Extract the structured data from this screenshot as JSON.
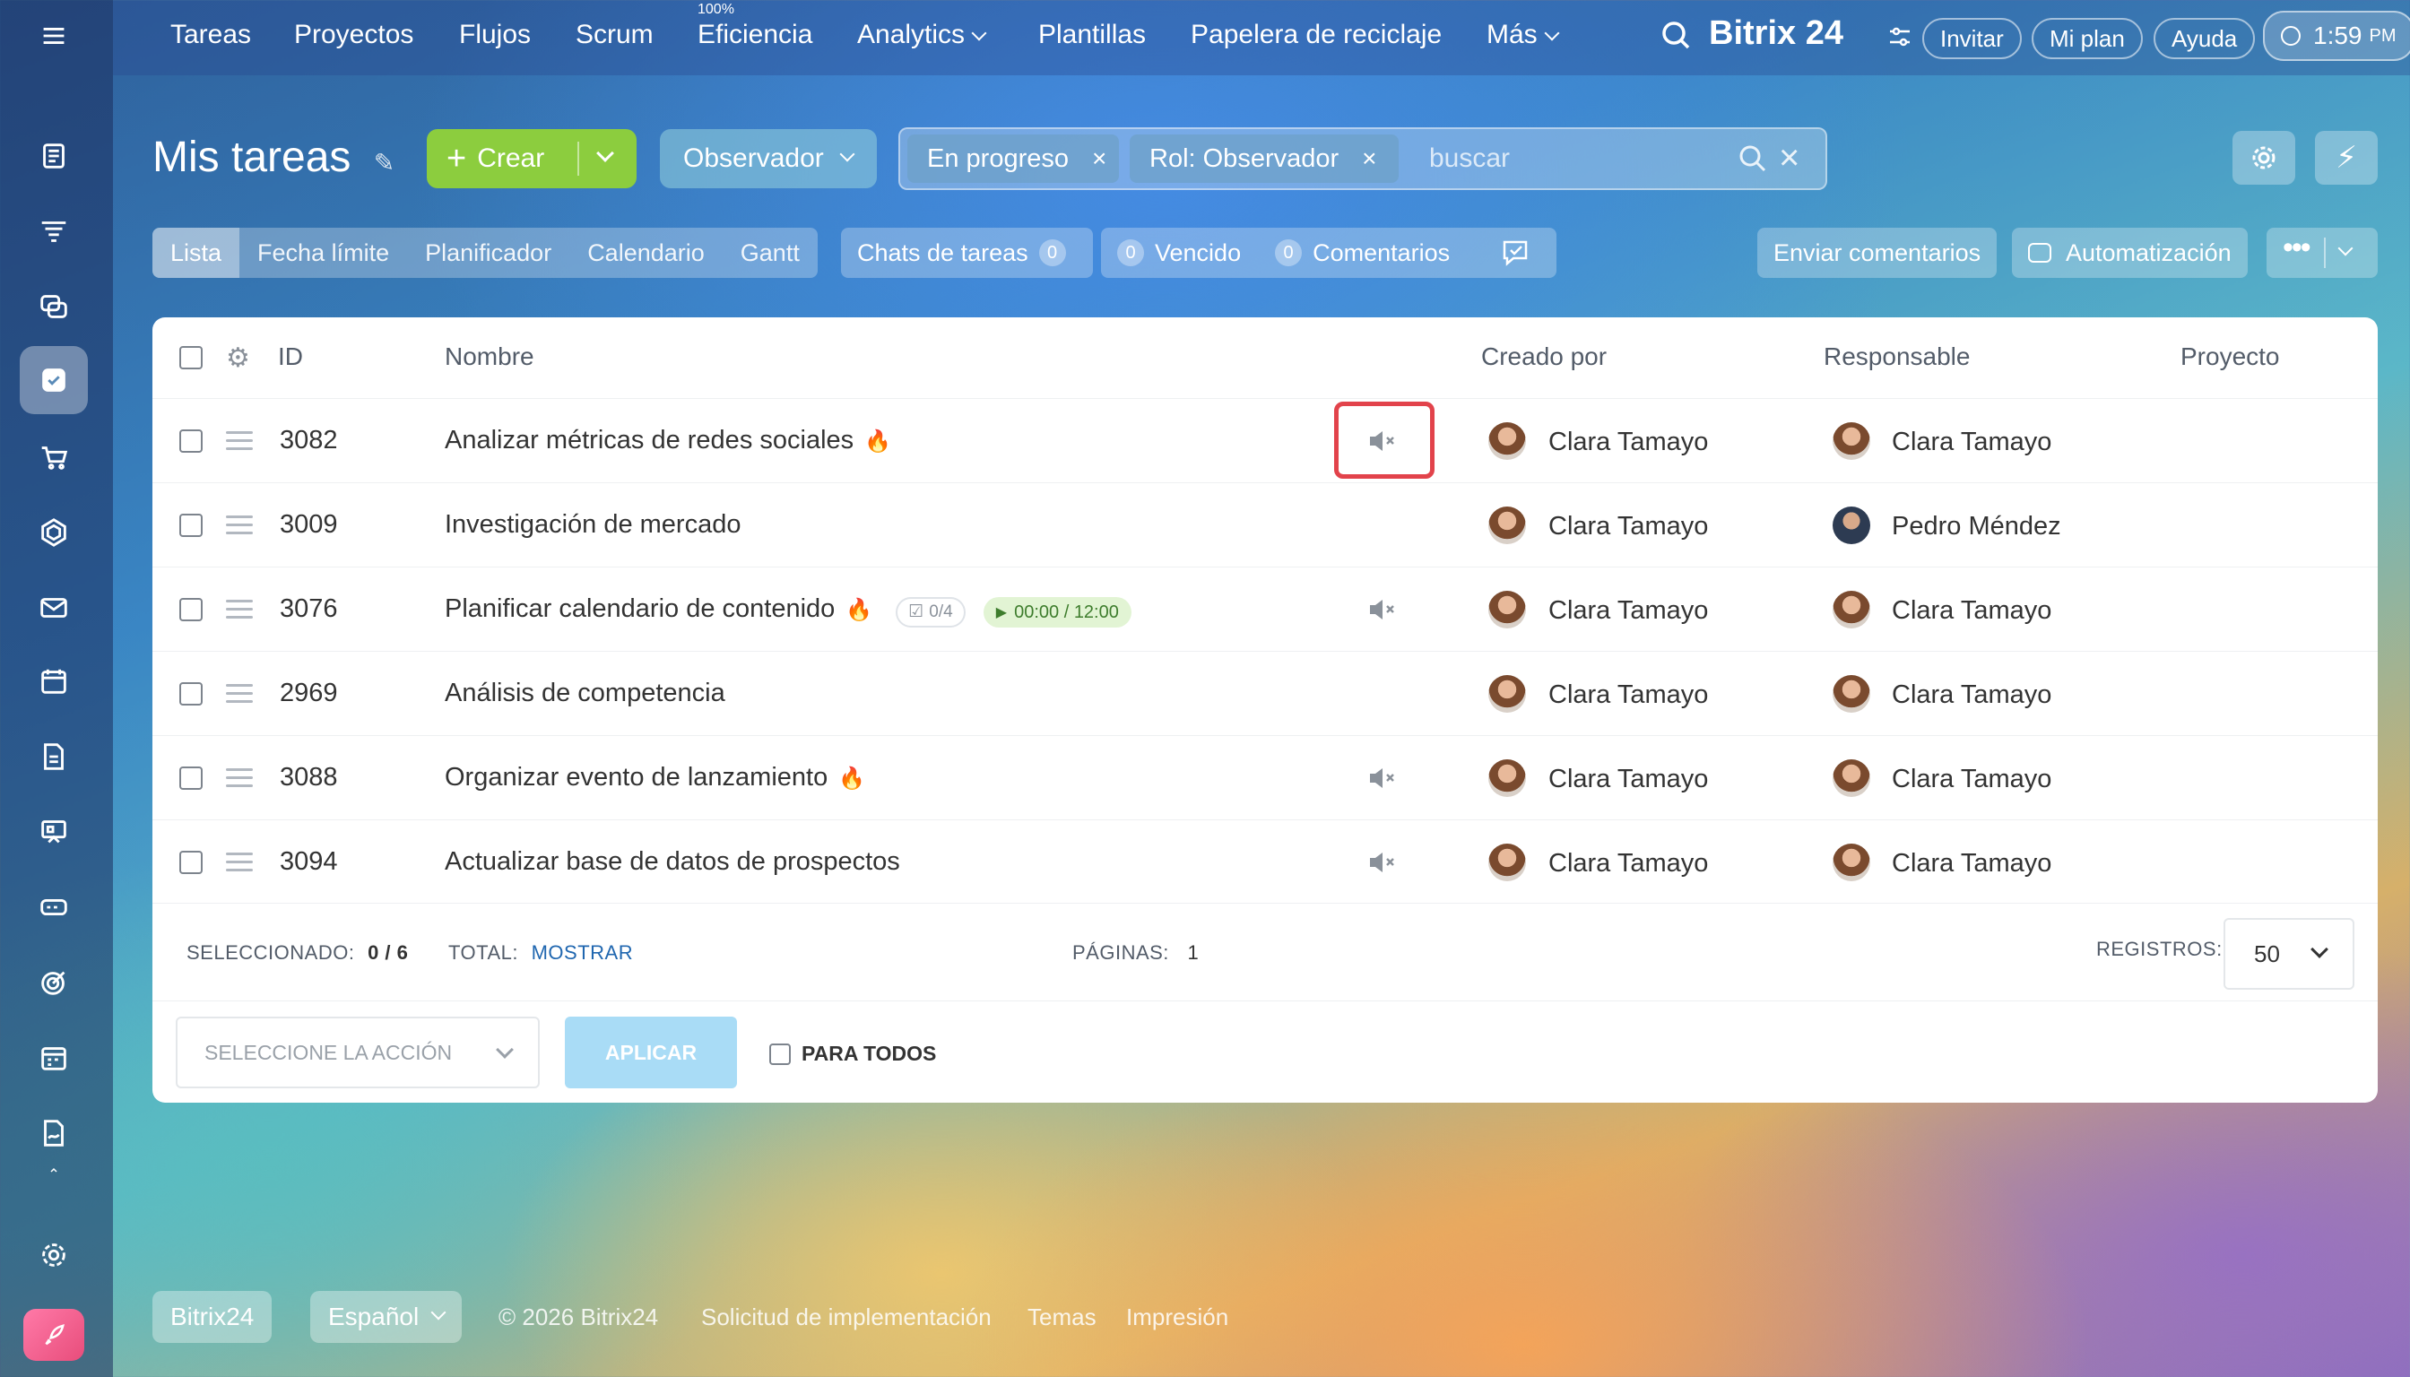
{
  "topnav": {
    "items": [
      "Tareas",
      "Proyectos",
      "Flujos",
      "Scrum",
      "Eficiencia",
      "Analytics",
      "Plantillas",
      "Papelera de reciclaje",
      "Más"
    ],
    "efficiency_badge": "100%",
    "brand": "Bitrix 24",
    "invite": "Invitar",
    "plan": "Mi plan",
    "help": "Ayuda",
    "time": "1:59",
    "time_suffix": "PM"
  },
  "header": {
    "title": "Mis tareas",
    "create": "Crear",
    "role_filter": "Observador",
    "chips": [
      "En progreso",
      "Rol: Observador"
    ],
    "search_placeholder": "buscar"
  },
  "views": [
    "Lista",
    "Fecha límite",
    "Planificador",
    "Calendario",
    "Gantt"
  ],
  "counters": {
    "chats_label": "Chats de tareas",
    "chats_count": "0",
    "overdue_count": "0",
    "overdue_label": "Vencido",
    "comments_count": "0",
    "comments_label": "Comentarios"
  },
  "actions": {
    "feedback": "Enviar comentarios",
    "automation": "Automatización"
  },
  "table": {
    "columns": [
      "ID",
      "Nombre",
      "Creado por",
      "Responsable",
      "Proyecto"
    ],
    "rows": [
      {
        "id": "3082",
        "name": "Analizar métricas de redes sociales",
        "creator": "Clara Tamayo",
        "assignee": "Clara Tamayo"
      },
      {
        "id": "3009",
        "name": "Investigación de mercado",
        "creator": "Clara Tamayo",
        "assignee": "Pedro Méndez"
      },
      {
        "id": "3076",
        "name": "Planificar calendario de contenido",
        "creator": "Clara Tamayo",
        "assignee": "Clara Tamayo",
        "checklist": "0/4",
        "timer": "00:00 / 12:00"
      },
      {
        "id": "2969",
        "name": "Análisis de competencia",
        "creator": "Clara Tamayo",
        "assignee": "Clara Tamayo"
      },
      {
        "id": "3088",
        "name": "Organizar evento de lanzamiento",
        "creator": "Clara Tamayo",
        "assignee": "Clara Tamayo"
      },
      {
        "id": "3094",
        "name": "Actualizar base de datos de prospectos",
        "creator": "Clara Tamayo",
        "assignee": "Clara Tamayo"
      }
    ]
  },
  "footer": {
    "selected_label": "SELECCIONADO:",
    "selected_value": "0 / 6",
    "total_label": "TOTAL:",
    "total_link": "MOSTRAR",
    "pages_label": "PÁGINAS:",
    "pages_value": "1",
    "records_label": "REGISTROS:",
    "records_value": "50",
    "select_action": "SELECCIONE LA ACCIÓN",
    "apply": "APLICAR",
    "for_all": "PARA TODOS"
  },
  "page_footer": {
    "brand": "Bitrix24",
    "language": "Español",
    "copyright": "© 2026 Bitrix24",
    "links": [
      "Solicitud de implementación",
      "Temas",
      "Impresión"
    ]
  }
}
